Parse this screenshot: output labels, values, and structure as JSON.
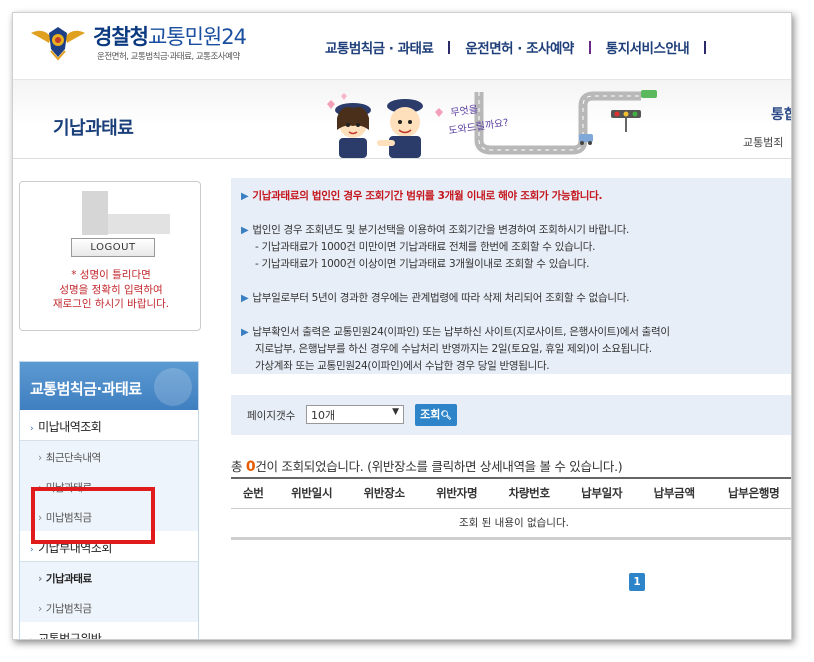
{
  "header": {
    "logo_main_1": "경찰청",
    "logo_main_2": "교통민원24",
    "logo_sub": "운전면허, 교통범칙금·과태료, 교통조사예약",
    "gnb": [
      "교통범칙금 · 과태료",
      "운전면허 · 조사예약",
      "통지서비스안내"
    ]
  },
  "banner": {
    "page_title": "기납과태료",
    "illustration_text": "무엇을 도와드릴까요?",
    "right_title": "통합",
    "right_sub": "교통범죄"
  },
  "login": {
    "logout_label": "LOGOUT",
    "message_lines": [
      "* 성명이 틀리다면",
      "성명을 정확히 입력하여",
      "재로그인 하시기 바랍니다."
    ]
  },
  "side_nav": {
    "title": "교통범칙금·과태료",
    "items": [
      {
        "label": "미납내역조회",
        "level": 1
      },
      {
        "label": "최근단속내역",
        "level": 2
      },
      {
        "label": "미납과태료",
        "level": 2
      },
      {
        "label": "미납범칙금",
        "level": 2
      },
      {
        "label": "기납부내역조회",
        "level": 1
      },
      {
        "label": "기납과태료",
        "level": 2,
        "active": true
      },
      {
        "label": "기납범칙금",
        "level": 2
      },
      {
        "label": "교통법규위반",
        "level": 1
      }
    ]
  },
  "info": {
    "line1": "기납과태료의 법인인 경우 조회기간 범위를 3개월 이내로 해야 조회가 가능합니다.",
    "line2": "법인인 경우 조회년도 및 분기선택을 이용하여 조회기간을 변경하여 조회하시기 바랍니다.",
    "line3": "- 기납과태료가 1000건 미만이면 기납과태료 전체를 한번에 조회할 수 있습니다.",
    "line4": "- 기납과태료가 1000건 이상이면 기납과태료 3개월이내로 조회할 수 있습니다.",
    "line5": "납부일로부터 5년이 경과한 경우에는 관계법령에 따라 삭제 처리되어 조회할 수 없습니다.",
    "line6": "납부확인서 출력은 교통민원24(이파인) 또는 납부하신 사이트(지로사이트, 은행사이트)에서 출력이",
    "line7": "지로납부, 은행납부를 하신 경우에 수납처리 반영까지는 2일(토요일, 휴일 제외)이 소요됩니다.",
    "line8": "가상계좌 또는 교통민원24(이파인)에서 수납한 경우 당일 반영됩니다."
  },
  "controls": {
    "page_size_label": "페이지갯수",
    "page_size_value": "10개",
    "search_label": "조회"
  },
  "result": {
    "count_prefix": "총 ",
    "count": "0",
    "count_suffix": "건이 조회되었습니다. (위반장소를 클릭하면 상세내역을 볼 수 있습니다.)",
    "columns": [
      "순번",
      "위반일시",
      "위반장소",
      "위반자명",
      "차량번호",
      "납부일자",
      "납부금액",
      "납부은행명"
    ],
    "empty_message": "조회 된 내용이 없습니다."
  },
  "pagination": {
    "current": "1"
  }
}
